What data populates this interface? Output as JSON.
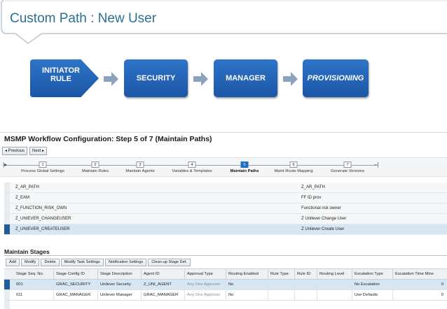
{
  "slide": {
    "title": "Custom Path : New User"
  },
  "flow": {
    "steps": [
      "INITIATOR RULE",
      "SECURITY",
      "MANAGER",
      "PROVISIONING"
    ],
    "initiator_line1": "INITIATOR",
    "initiator_line2": "RULE",
    "box_color": "#1f5fb0",
    "arrow_color": "#8aa2bf"
  },
  "sap": {
    "title": "MSMP Workflow Configuration: Step 5  of 7  (Maintain Paths)",
    "nav": {
      "previous": "◂ Previous",
      "next": "Next ▸"
    },
    "wizard": [
      {
        "num": "1",
        "label": "Process Global Settings"
      },
      {
        "num": "2",
        "label": "Maintain Rules"
      },
      {
        "num": "3",
        "label": "Maintain Agents"
      },
      {
        "num": "4",
        "label": "Variables & Templates"
      },
      {
        "num": "5",
        "label": "Maintain Paths",
        "active": true
      },
      {
        "num": "6",
        "label": "Maint Route Mapping"
      },
      {
        "num": "7",
        "label": "Generate Versions"
      }
    ],
    "paths": [
      {
        "id": "Z_AR_PATH",
        "desc": "Z_AR_PATH"
      },
      {
        "id": "Z_EAM",
        "desc": "FF ID prov"
      },
      {
        "id": "Z_FUNCTION_RISK_OWN",
        "desc": "Functional risk owner"
      },
      {
        "id": "Z_UNIEVER_CHANGEUSER",
        "desc": "Z Unilever Change User"
      },
      {
        "id": "Z_UNIEVER_CREATEUSER",
        "desc": "Z Unilever Create User",
        "selected": true
      }
    ],
    "stages_title": "Maintain Stages",
    "toolbar": [
      "Add",
      "Modify",
      "Delete",
      "Modify Task Settings",
      "Notification Settings",
      "Clean-up Stage Def."
    ],
    "columns": [
      "Stage Seq. No.",
      "Stage Config ID",
      "Stage Description",
      "Agent ID",
      "Approval Type",
      "Routing Enabled",
      "Rule Type",
      "Rule ID",
      "Routing Level",
      "Escalation Type",
      "Escalation Time Mins"
    ],
    "rows": [
      {
        "seq": "001",
        "config": "GRAC_SECURITY",
        "desc": "Unilever Security",
        "agent": "Z_UNI_AGENT",
        "approval": "Any One Approver",
        "routing": "No",
        "rule_type": "",
        "rule_id": "",
        "level": "",
        "esc_type": "No Escalation",
        "esc_time": "0",
        "selected": true
      },
      {
        "seq": "011",
        "config": "GRAC_MANAGER",
        "desc": "Unilever Manager",
        "agent": "GRAC_MANAGER",
        "approval": "Any One Approver",
        "routing": "No",
        "rule_type": "",
        "rule_id": "",
        "level": "",
        "esc_type": "Use Defaults",
        "esc_time": "0"
      }
    ]
  }
}
